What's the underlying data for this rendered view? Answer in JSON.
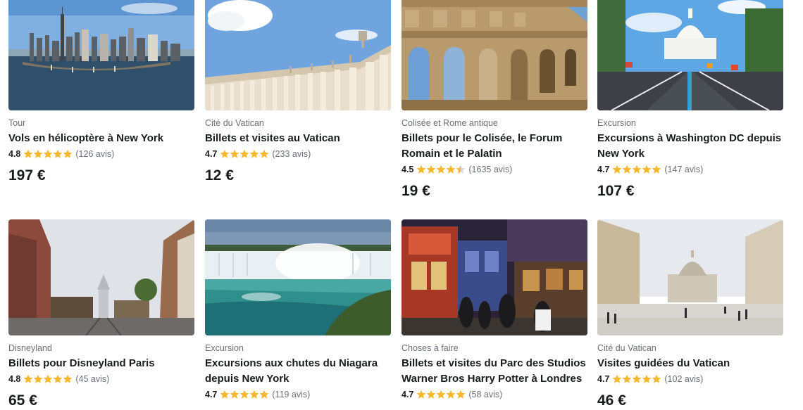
{
  "colors": {
    "star": "#f5b82e",
    "text": "#1a1b1d",
    "muted": "#6b6f78"
  },
  "cards": [
    {
      "category": "Tour",
      "title": "Vols en hélicoptère à New York",
      "score": "4.8",
      "stars": 5,
      "reviews": "(126 avis)",
      "price": "197 €",
      "image": "new-york-skyline-image"
    },
    {
      "category": "Cité du Vatican",
      "title": "Billets et visites au Vatican",
      "score": "4.7",
      "stars": 5,
      "reviews": "(233 avis)",
      "price": "12 €",
      "image": "vatican-colonnade-image"
    },
    {
      "category": "Colisée et Rome antique",
      "title": "Billets pour le Colisée, le Forum Romain et le Palatin",
      "score": "4.5",
      "stars": 4.5,
      "reviews": "(1635 avis)",
      "price": "19 €",
      "image": "colosseum-image"
    },
    {
      "category": "Excursion",
      "title": "Excursions à Washington DC depuis New York",
      "score": "4.7",
      "stars": 5,
      "reviews": "(147 avis)",
      "price": "107 €",
      "image": "capitol-image"
    },
    {
      "category": "Disneyland",
      "title": "Billets pour Disneyland Paris",
      "score": "4.8",
      "stars": 5,
      "reviews": "(45 avis)",
      "price": "65 €",
      "image": "disneyland-main-street-image"
    },
    {
      "category": "Excursion",
      "title": "Excursions aux chutes du Niagara depuis New York",
      "score": "4.7",
      "stars": 5,
      "reviews": "(119 avis)",
      "price": "",
      "image": "niagara-falls-image"
    },
    {
      "category": "Choses à faire",
      "title": "Billets et visites du Parc des Studios Warner Bros Harry Potter à Londres",
      "score": "4.7",
      "stars": 5,
      "reviews": "(58 avis)",
      "price": "",
      "image": "harry-potter-studio-image"
    },
    {
      "category": "Cité du Vatican",
      "title": "Visites guidées du Vatican",
      "score": "4.7",
      "stars": 5,
      "reviews": "(102 avis)",
      "price": "46 €",
      "image": "st-peters-square-image"
    }
  ]
}
